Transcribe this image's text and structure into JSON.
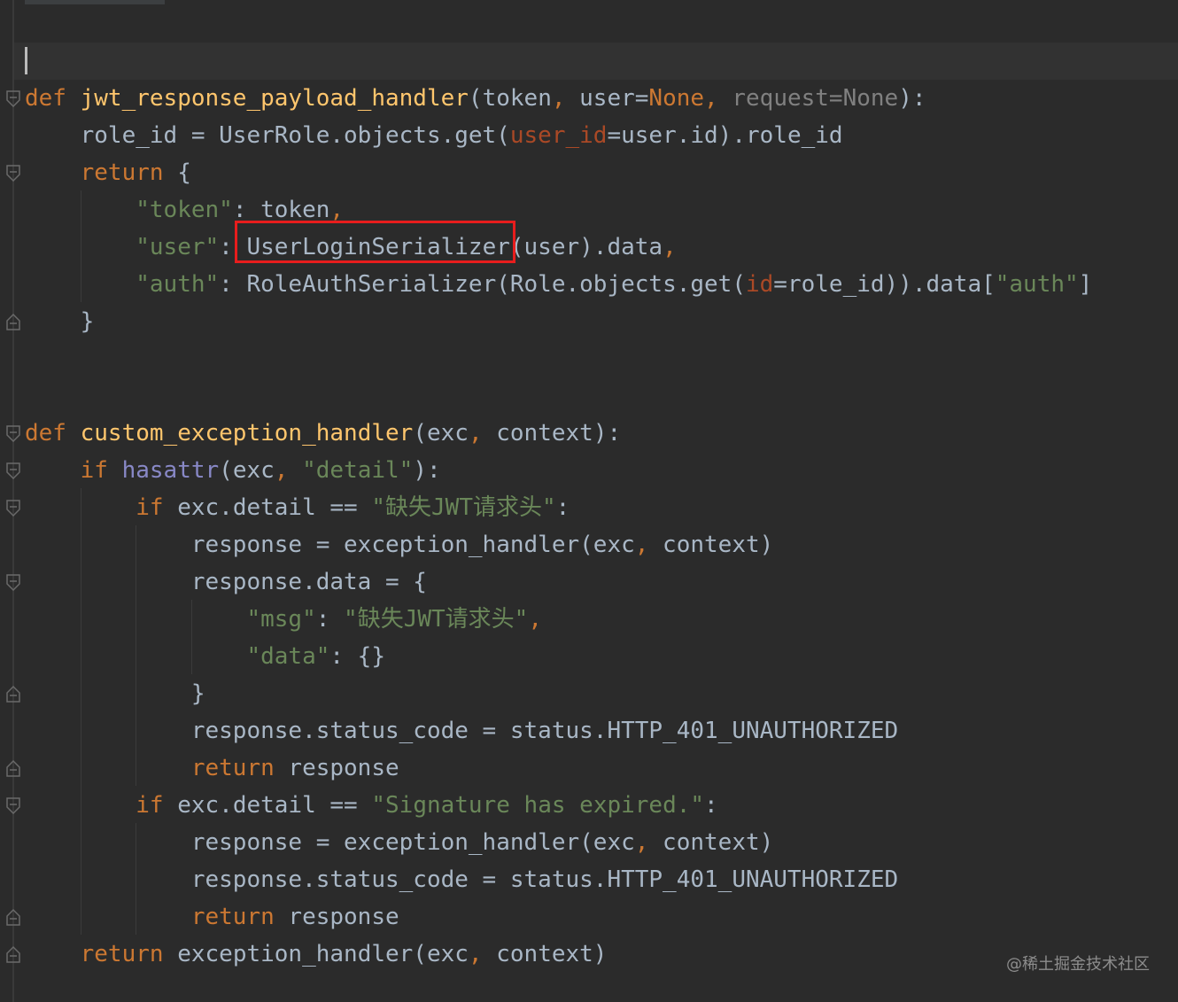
{
  "editor": {
    "theme_colors": {
      "background": "#2b2b2b",
      "keyword": "#cc7832",
      "function": "#ffc66d",
      "string": "#6a8759",
      "named_argument": "#aa4926",
      "builtin": "#8888c6",
      "default_text": "#a9b7c6",
      "highlight_box": "#e81d1d"
    },
    "lines": [
      {
        "tokens": [],
        "note": ""
      },
      {
        "tokens": [
          {
            "t": "def",
            "c": "kw"
          },
          {
            "t": " ",
            "c": ""
          },
          {
            "t": "jwt_response_payload_handler",
            "c": "fn"
          },
          {
            "t": "(token",
            "c": ""
          },
          {
            "t": ",",
            "c": "kw"
          },
          {
            "t": " user=",
            "c": ""
          },
          {
            "t": "None",
            "c": "kw"
          },
          {
            "t": ",",
            "c": "kw"
          },
          {
            "t": " request=None",
            "c": "param-dim"
          },
          {
            "t": "):",
            "c": ""
          }
        ]
      },
      {
        "tokens": [
          {
            "t": "    role_id = UserRole.objects.get(",
            "c": ""
          },
          {
            "t": "user_id",
            "c": "named-arg"
          },
          {
            "t": "=user.id).role_id",
            "c": ""
          }
        ]
      },
      {
        "tokens": [
          {
            "t": "    ",
            "c": ""
          },
          {
            "t": "return",
            "c": "kw"
          },
          {
            "t": " {",
            "c": ""
          }
        ]
      },
      {
        "tokens": [
          {
            "t": "        ",
            "c": ""
          },
          {
            "t": "\"token\"",
            "c": "str"
          },
          {
            "t": ": token",
            "c": ""
          },
          {
            "t": ",",
            "c": "kw"
          }
        ]
      },
      {
        "tokens": [
          {
            "t": "        ",
            "c": ""
          },
          {
            "t": "\"user\"",
            "c": "str"
          },
          {
            "t": ": UserLoginSerializer(user).data",
            "c": ""
          },
          {
            "t": ",",
            "c": "kw"
          }
        ]
      },
      {
        "tokens": [
          {
            "t": "        ",
            "c": ""
          },
          {
            "t": "\"auth\"",
            "c": "str"
          },
          {
            "t": ": RoleAuthSerializer(Role.objects.get(",
            "c": ""
          },
          {
            "t": "id",
            "c": "named-arg"
          },
          {
            "t": "=role_id)).data[",
            "c": ""
          },
          {
            "t": "\"auth\"",
            "c": "str"
          },
          {
            "t": "]",
            "c": ""
          }
        ]
      },
      {
        "tokens": [
          {
            "t": "    }",
            "c": ""
          }
        ]
      },
      {
        "tokens": []
      },
      {
        "tokens": []
      },
      {
        "tokens": [
          {
            "t": "def",
            "c": "kw"
          },
          {
            "t": " ",
            "c": ""
          },
          {
            "t": "custom_exception_handler",
            "c": "fn"
          },
          {
            "t": "(exc",
            "c": ""
          },
          {
            "t": ",",
            "c": "kw"
          },
          {
            "t": " context):",
            "c": ""
          }
        ]
      },
      {
        "tokens": [
          {
            "t": "    ",
            "c": ""
          },
          {
            "t": "if",
            "c": "kw"
          },
          {
            "t": " ",
            "c": ""
          },
          {
            "t": "hasattr",
            "c": "builtin"
          },
          {
            "t": "(exc",
            "c": ""
          },
          {
            "t": ",",
            "c": "kw"
          },
          {
            "t": " ",
            "c": ""
          },
          {
            "t": "\"detail\"",
            "c": "str"
          },
          {
            "t": "):",
            "c": ""
          }
        ]
      },
      {
        "tokens": [
          {
            "t": "        ",
            "c": ""
          },
          {
            "t": "if",
            "c": "kw"
          },
          {
            "t": " exc.detail == ",
            "c": ""
          },
          {
            "t": "\"缺失JWT请求头\"",
            "c": "str"
          },
          {
            "t": ":",
            "c": ""
          }
        ]
      },
      {
        "tokens": [
          {
            "t": "            response = exception_handler(exc",
            "c": ""
          },
          {
            "t": ",",
            "c": "kw"
          },
          {
            "t": " context)",
            "c": ""
          }
        ]
      },
      {
        "tokens": [
          {
            "t": "            response.data = {",
            "c": ""
          }
        ]
      },
      {
        "tokens": [
          {
            "t": "                ",
            "c": ""
          },
          {
            "t": "\"msg\"",
            "c": "str"
          },
          {
            "t": ": ",
            "c": ""
          },
          {
            "t": "\"缺失JWT请求头\"",
            "c": "str"
          },
          {
            "t": ",",
            "c": "kw"
          }
        ]
      },
      {
        "tokens": [
          {
            "t": "                ",
            "c": ""
          },
          {
            "t": "\"data\"",
            "c": "str"
          },
          {
            "t": ": {}",
            "c": ""
          }
        ]
      },
      {
        "tokens": [
          {
            "t": "            }",
            "c": ""
          }
        ]
      },
      {
        "tokens": [
          {
            "t": "            response.status_code = status.HTTP_401_UNAUTHORIZED",
            "c": ""
          }
        ]
      },
      {
        "tokens": [
          {
            "t": "            ",
            "c": ""
          },
          {
            "t": "return",
            "c": "kw"
          },
          {
            "t": " response",
            "c": ""
          }
        ]
      },
      {
        "tokens": [
          {
            "t": "        ",
            "c": ""
          },
          {
            "t": "if",
            "c": "kw"
          },
          {
            "t": " exc.detail == ",
            "c": ""
          },
          {
            "t": "\"Signature has expired.\"",
            "c": "str"
          },
          {
            "t": ":",
            "c": ""
          }
        ]
      },
      {
        "tokens": [
          {
            "t": "            response = exception_handler(exc",
            "c": ""
          },
          {
            "t": ",",
            "c": "kw"
          },
          {
            "t": " context)",
            "c": ""
          }
        ]
      },
      {
        "tokens": [
          {
            "t": "            response.status_code = status.HTTP_401_UNAUTHORIZED",
            "c": ""
          }
        ]
      },
      {
        "tokens": [
          {
            "t": "            ",
            "c": ""
          },
          {
            "t": "return",
            "c": "kw"
          },
          {
            "t": " response",
            "c": ""
          }
        ]
      },
      {
        "tokens": [
          {
            "t": "    ",
            "c": ""
          },
          {
            "t": "return",
            "c": "kw"
          },
          {
            "t": " exception_handler(exc",
            "c": ""
          },
          {
            "t": ",",
            "c": "kw"
          },
          {
            "t": " context)",
            "c": ""
          }
        ]
      }
    ]
  },
  "watermark": "@稀土掘金技术社区"
}
